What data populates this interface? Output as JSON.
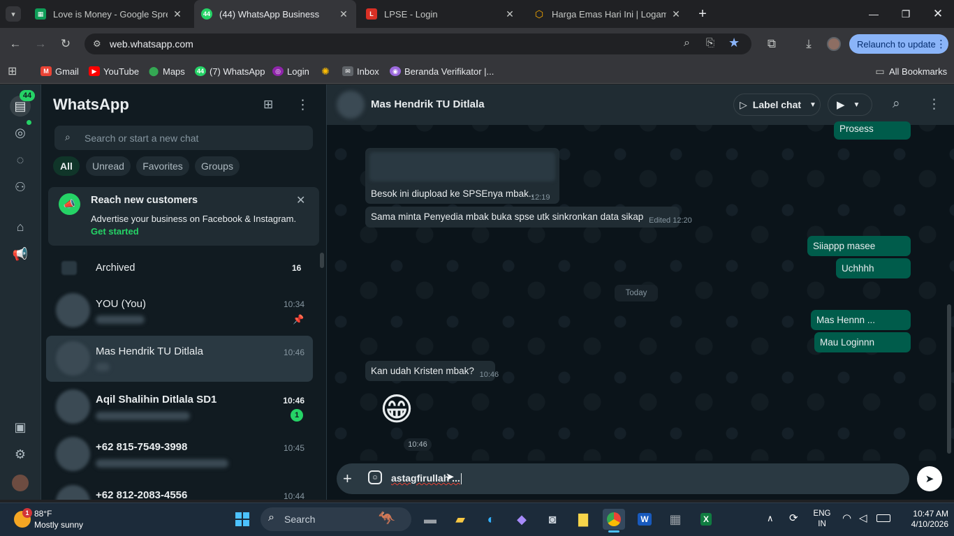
{
  "browser": {
    "tabs": [
      {
        "title": "Love is Money - Google Spread",
        "icon": "sheets-icon",
        "color": "#0f9d58"
      },
      {
        "title": "(44) WhatsApp Business",
        "icon": "whatsapp-business-icon",
        "color": "#25d366"
      },
      {
        "title": "LPSE - Login",
        "icon": "lpse-icon",
        "color": "#d93025"
      },
      {
        "title": "Harga Emas Hari Ini | Logam M",
        "icon": "gold-icon",
        "color": "#f9ab00"
      }
    ],
    "url": "web.whatsapp.com",
    "relaunch_label": "Relaunch to update",
    "bookmarks": [
      {
        "label": "Gmail",
        "color": "#ea4335"
      },
      {
        "label": "YouTube",
        "color": "#ff0000"
      },
      {
        "label": "Maps",
        "color": "#34a853"
      },
      {
        "label": "(7) WhatsApp",
        "color": "#25d366"
      },
      {
        "label": "Login",
        "color": "#8e24aa"
      },
      {
        "label": "",
        "color": "#fbbc04"
      },
      {
        "label": "Inbox",
        "color": "#9aa0a6"
      },
      {
        "label": "Beranda Verifikator |...",
        "color": "#9c6ade"
      }
    ],
    "all_bookmarks_label": "All Bookmarks"
  },
  "wa": {
    "rail": {
      "unread_badge": "44"
    },
    "title": "WhatsApp",
    "search_placeholder": "Search or start a new chat",
    "filters": [
      "All",
      "Unread",
      "Favorites",
      "Groups"
    ],
    "promo": {
      "title": "Reach new customers",
      "body": "Advertise your business on Facebook & Instagram.",
      "cta": "Get started"
    },
    "archived": {
      "label": "Archived",
      "count": "16"
    },
    "chats": [
      {
        "name": "YOU (You)",
        "time": "10:34"
      },
      {
        "name": "Mas Hendrik TU Ditlala",
        "time": "10:46"
      },
      {
        "name": "Aqil Shalihin Ditlala SD1",
        "time": "10:46",
        "unread": "1"
      },
      {
        "name": "+62 815-7549-3998",
        "time": "10:45"
      },
      {
        "name": "+62 812-2083-4556",
        "time": "10:44"
      }
    ],
    "conversation": {
      "contact": "Mas Hendrik TU Ditlala",
      "label_chat": "Label chat",
      "messages": {
        "m0": {
          "text": "Prosess"
        },
        "m1": {
          "text": "Besok ini diupload ke SPSEnya mbak..",
          "time": "12:19"
        },
        "m2": {
          "text": "Sama minta Penyedia mbak buka spse utk sinkronkan data sikap",
          "time": "Edited 12:20"
        },
        "m3": {
          "text": "Siiappp masee"
        },
        "m4": {
          "text": "Uchhhh"
        },
        "day": "Today",
        "m5": {
          "text": "Mas Hennn ..."
        },
        "m6": {
          "text": "Mau Loginnn"
        },
        "m7": {
          "text": "Kan udah Kristen mbak?",
          "time": "10:46"
        },
        "m8": {
          "emoji": "😁",
          "time": "10:46"
        }
      },
      "draft": "astagfirullah ..."
    }
  },
  "taskbar": {
    "weather": {
      "temp": "88°F",
      "desc": "Mostly sunny",
      "badge": "1"
    },
    "search_label": "Search",
    "lang": {
      "top": "ENG",
      "bottom": "IN"
    },
    "time": "10:47 AM",
    "date": "4/10/2026"
  }
}
